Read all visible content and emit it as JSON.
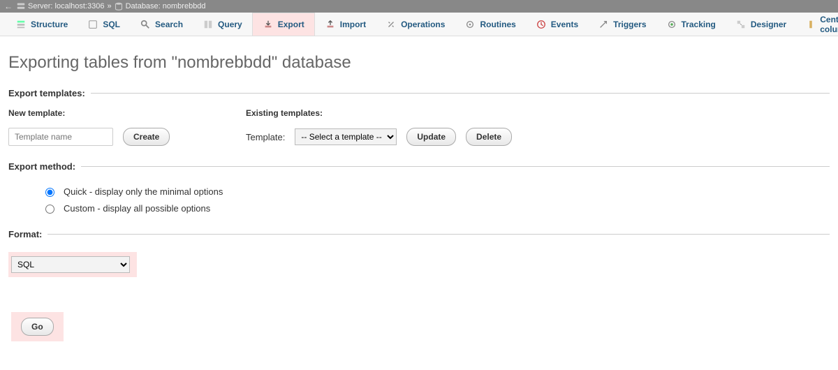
{
  "breadcrumb": {
    "server_label": "Server: localhost:3306",
    "separator": "»",
    "database_label": "Database: nombrebbdd"
  },
  "tabs": [
    {
      "id": "structure",
      "label": "Structure",
      "icon": "structure-icon"
    },
    {
      "id": "sql",
      "label": "SQL",
      "icon": "sql-icon"
    },
    {
      "id": "search",
      "label": "Search",
      "icon": "search-icon"
    },
    {
      "id": "query",
      "label": "Query",
      "icon": "query-icon"
    },
    {
      "id": "export",
      "label": "Export",
      "icon": "export-icon",
      "active": true,
      "highlight": true
    },
    {
      "id": "import",
      "label": "Import",
      "icon": "import-icon"
    },
    {
      "id": "operations",
      "label": "Operations",
      "icon": "operations-icon"
    },
    {
      "id": "routines",
      "label": "Routines",
      "icon": "routines-icon"
    },
    {
      "id": "events",
      "label": "Events",
      "icon": "events-icon"
    },
    {
      "id": "triggers",
      "label": "Triggers",
      "icon": "triggers-icon"
    },
    {
      "id": "tracking",
      "label": "Tracking",
      "icon": "tracking-icon"
    },
    {
      "id": "designer",
      "label": "Designer",
      "icon": "designer-icon"
    },
    {
      "id": "centralcols",
      "label": "Central columns",
      "icon": "central-columns-icon"
    }
  ],
  "title": "Exporting tables from \"nombrebbdd\" database",
  "sections": {
    "export_templates": {
      "legend": "Export templates:",
      "new_template_label": "New template:",
      "template_name_placeholder": "Template name",
      "create_label": "Create",
      "existing_templates_label": "Existing templates:",
      "template_label": "Template:",
      "template_select_placeholder": "-- Select a template --",
      "update_label": "Update",
      "delete_label": "Delete"
    },
    "export_method": {
      "legend": "Export method:",
      "quick_label": "Quick - display only the minimal options",
      "custom_label": "Custom - display all possible options"
    },
    "format": {
      "legend": "Format:",
      "selected": "SQL"
    }
  },
  "go_label": "Go"
}
